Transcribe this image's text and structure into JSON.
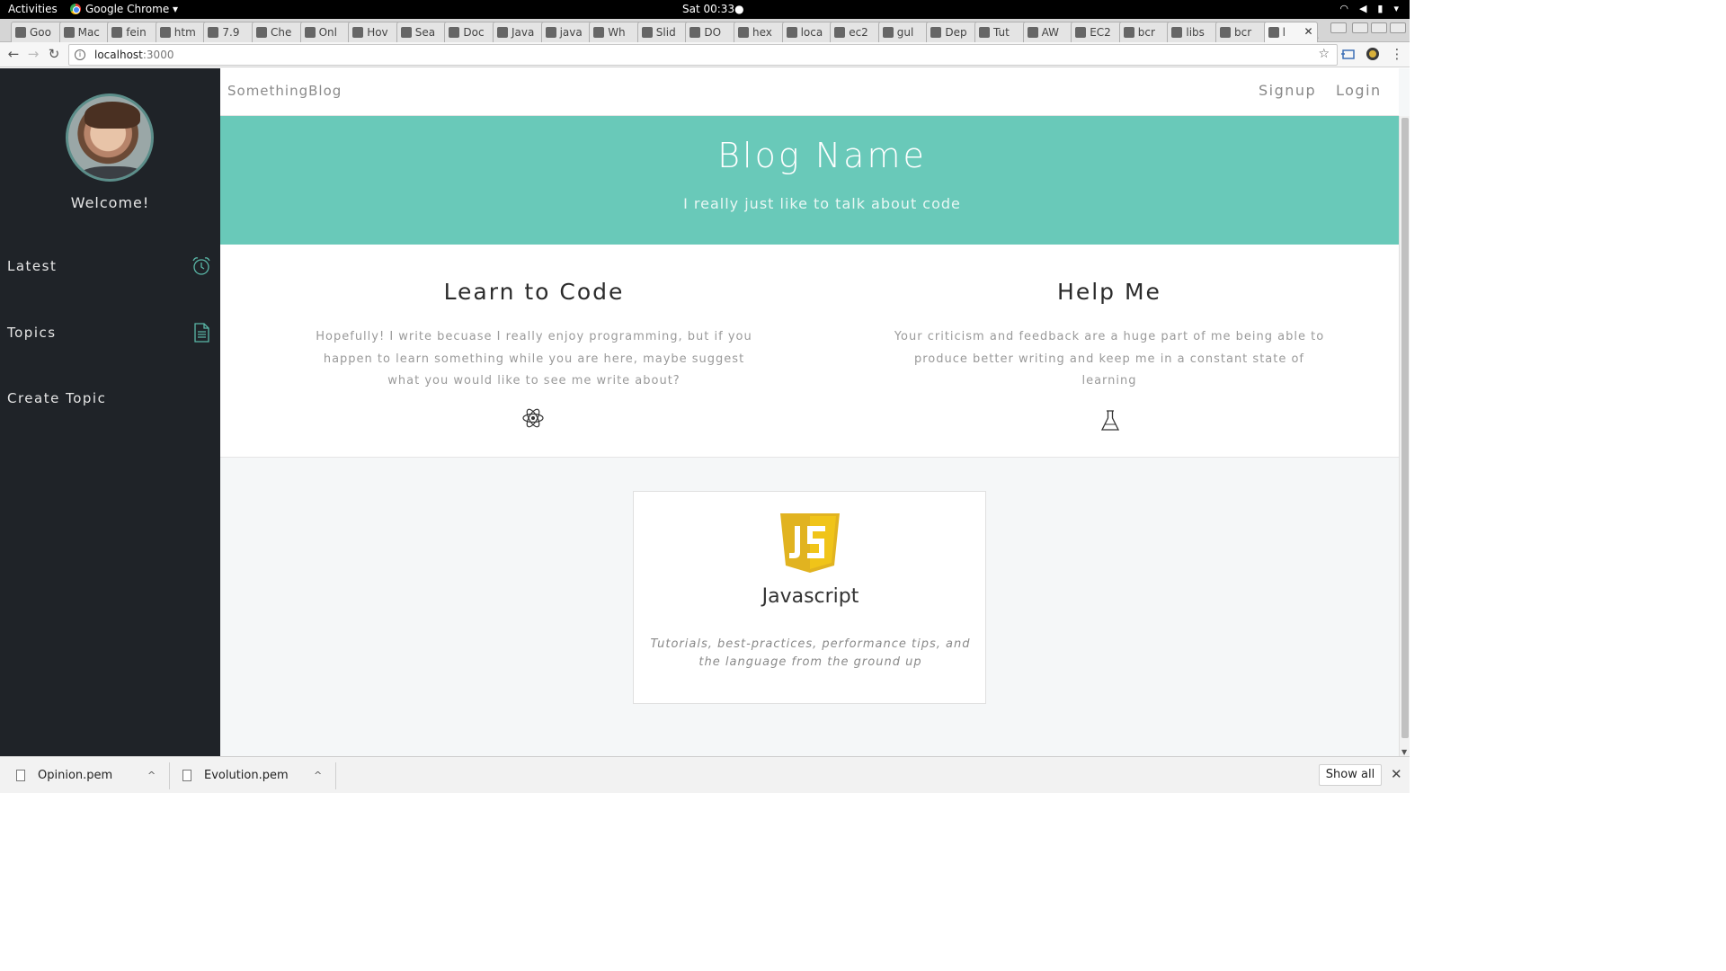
{
  "topbar": {
    "activities": "Activities",
    "app_name": "Google Chrome ▾",
    "clock": "Sat 00:33●"
  },
  "browser": {
    "tabs": [
      "Goo",
      "Mac",
      "fein",
      "htm",
      "7.9",
      "Che",
      "Onl",
      "Hov",
      "Sea",
      "Doc",
      "Java",
      "java",
      "Wh",
      "Slid",
      "DO",
      "hex",
      "loca",
      "ec2",
      "gul",
      "Dep",
      "Tut",
      "AW",
      "EC2",
      "bcr",
      "libs",
      "bcr",
      "l"
    ],
    "url_host": "localhost",
    "url_port": ":3000"
  },
  "sidebar": {
    "welcome": "Welcome!",
    "items": [
      {
        "label": "Latest",
        "icon": "alarm-clock-icon"
      },
      {
        "label": "Topics",
        "icon": "document-icon"
      },
      {
        "label": "Create Topic",
        "icon": ""
      }
    ],
    "accent": "#5ab8a8",
    "bg": "#1f2328"
  },
  "navbar": {
    "brand": "SomethingBlog",
    "links": [
      "Signup",
      "Login"
    ]
  },
  "hero": {
    "title": "Blog Name",
    "subtitle": "I really just like to talk about code",
    "bg": "#69c9b9"
  },
  "features": [
    {
      "title": "Learn to Code",
      "text": "Hopefully! I write becuase I really enjoy programming, but if you happen to learn something while you are here, maybe suggest what you would like to see me write about?",
      "icon": "atom-icon"
    },
    {
      "title": "Help Me",
      "text": "Your criticism and feedback are a huge part of me being able to produce better writing and keep me in a constant state of learning",
      "icon": "flask-icon"
    }
  ],
  "topic_card": {
    "title": "Javascript",
    "description": "Tutorials, best-practices, performance tips, and the language from the ground up",
    "logo_text": "JS",
    "logo_color": "#f0c419"
  },
  "downloads": {
    "files": [
      "Opinion.pem",
      "Evolution.pem"
    ],
    "show_all": "Show all"
  }
}
